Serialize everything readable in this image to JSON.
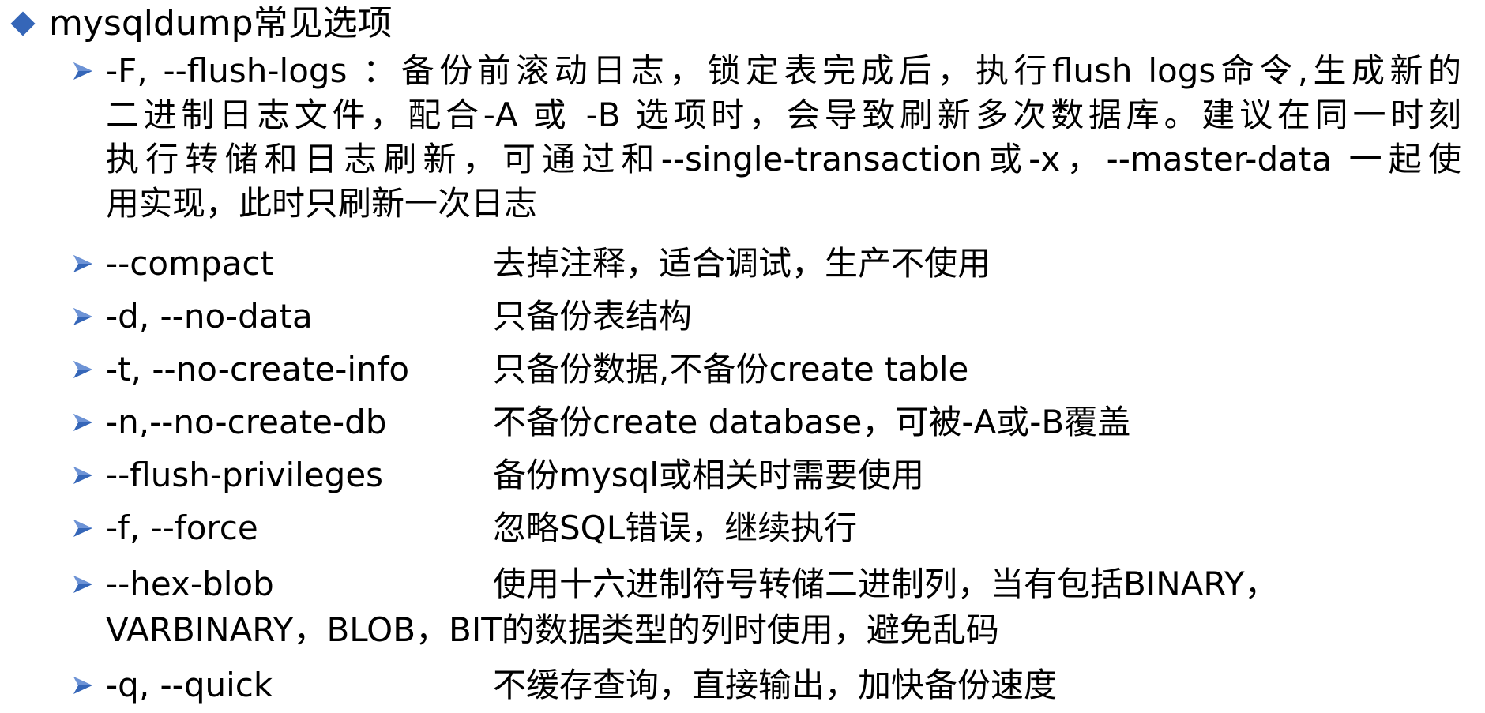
{
  "title": "mysqldump常见选项",
  "accent_color": "#3566b8",
  "bullet_icon": "arrow-bullet-icon",
  "title_icon": "diamond-bullet-icon",
  "flush_logs": {
    "lines": [
      "-F, --flush-logs ：备份前滚动日志，锁定表完成后，执行flush logs命令,生成新的",
      "二进制日志文件，配合-A 或 -B 选项时，会导致刷新多次数据库。建议在同一时刻",
      "执行转储和日志刷新，可通过和--single-transaction或-x，--master-data 一起使",
      "用实现，此时只刷新一次日志"
    ]
  },
  "options": [
    {
      "option": "--compact",
      "description": "去掉注释，适合调试，生产不使用"
    },
    {
      "option": "-d, --no-data",
      "description": "只备份表结构"
    },
    {
      "option": "-t, --no-create-info",
      "description": "只备份数据,不备份create table"
    },
    {
      "option": "-n,--no-create-db",
      "description": "不备份create database，可被-A或-B覆盖"
    },
    {
      "option": "--flush-privileges",
      "description": "备份mysql或相关时需要使用"
    },
    {
      "option": "-f, --force",
      "description": "忽略SQL错误，继续执行"
    },
    {
      "option": "--hex-blob",
      "description": "使用十六进制符号转储二进制列，当有包括BINARY，",
      "continuation": "VARBINARY，BLOB，BIT的数据类型的列时使用，避免乱码"
    },
    {
      "option": "-q, --quick",
      "description": "不缓存查询，直接输出，加快备份速度"
    }
  ]
}
